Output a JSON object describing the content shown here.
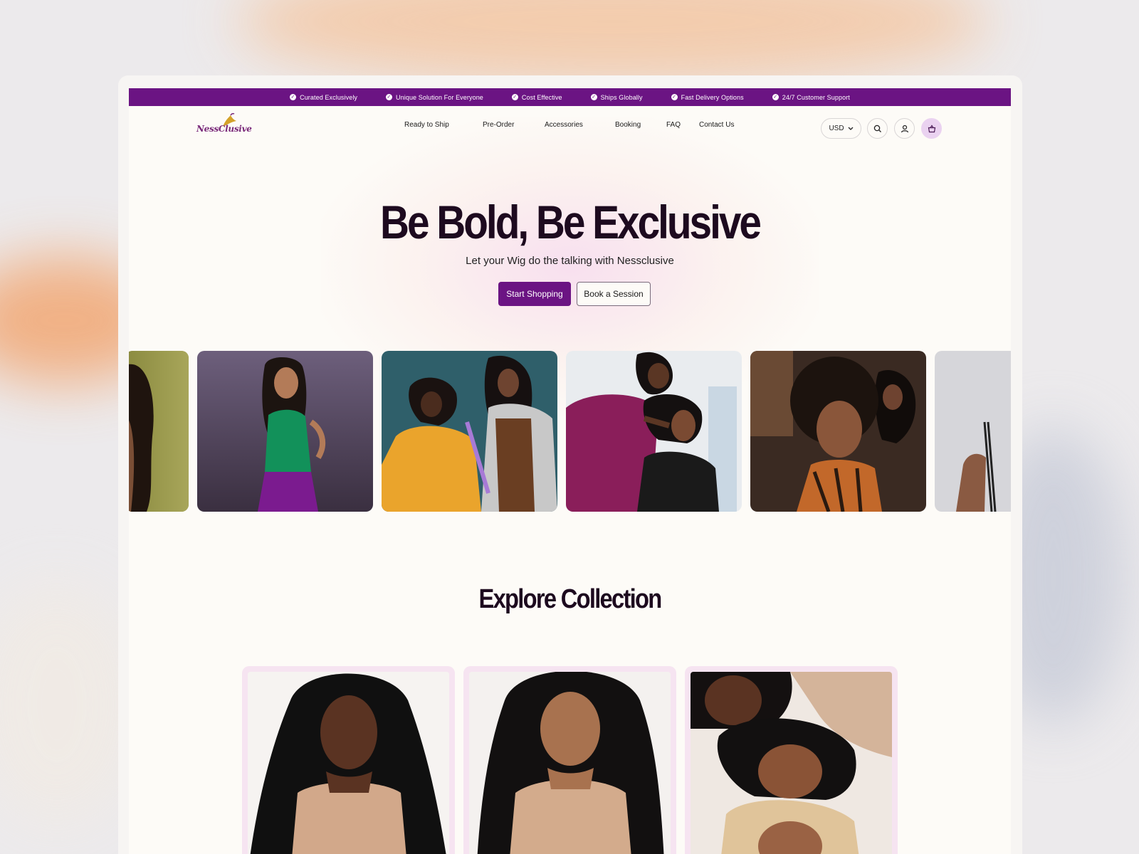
{
  "announcement": {
    "items": [
      "Curated Exclusively",
      "Unique Solution For Everyone",
      "Cost Effective",
      "Ships Globally",
      "Fast Delivery Options",
      "24/7 Customer Support"
    ]
  },
  "brand": {
    "logo_text": "NessClusive"
  },
  "nav": {
    "links": [
      "Ready to Ship",
      "Pre-Order",
      "Accessories",
      "Booking",
      "FAQ",
      "Contact Us"
    ],
    "currency": "USD"
  },
  "hero": {
    "title": "Be Bold, Be Exclusive",
    "subtitle": "Let your Wig do the talking with Nessclusive",
    "primary_cta": "Start Shopping",
    "secondary_cta": "Book a Session"
  },
  "gallery": {
    "images": [
      "woman-curly-hair-olive-background",
      "woman-long-braids-green-top",
      "stylist-braiding-client-hair",
      "stylist-styling-client-hair",
      "smiling-woman-curly-afro",
      "woman-braids-grey-background"
    ]
  },
  "collection": {
    "title": "Explore Collection",
    "items": [
      "woman-curly-black-wig",
      "woman-body-wave-wig",
      "three-women-hair-group"
    ]
  },
  "colors": {
    "brand_purple": "#6b1483",
    "heading": "#1d0a1f",
    "card_pink": "#f6e4f1",
    "page_bg": "#fdfbf7"
  }
}
